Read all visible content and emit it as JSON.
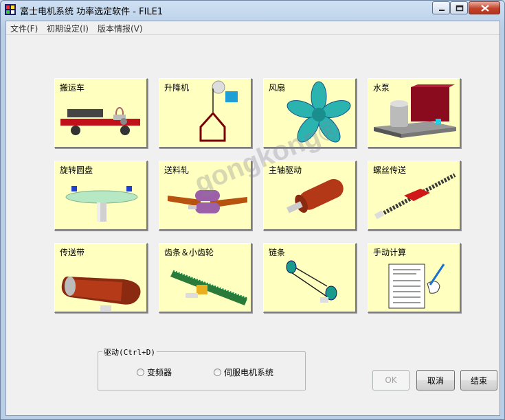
{
  "window": {
    "title": "富士电机系统  功率选定软件 - FILE1"
  },
  "menu": [
    {
      "label": "文件(F)"
    },
    {
      "label": "初期设定(I)"
    },
    {
      "label": "版本情报(V)"
    }
  ],
  "tiles": [
    {
      "label": "搬运车",
      "icon": "cart-icon"
    },
    {
      "label": "升降机",
      "icon": "hoist-icon"
    },
    {
      "label": "风扇",
      "icon": "fan-icon"
    },
    {
      "label": "水泵",
      "icon": "pump-icon"
    },
    {
      "label": "旋转圆盘",
      "icon": "turntable-icon"
    },
    {
      "label": "送料轧",
      "icon": "feed-roll-icon"
    },
    {
      "label": "主轴驱动",
      "icon": "spindle-icon"
    },
    {
      "label": "螺丝传送",
      "icon": "screw-conveyor-icon"
    },
    {
      "label": "传送带",
      "icon": "conveyor-belt-icon"
    },
    {
      "label": "齿条＆小齿轮",
      "icon": "rack-pinion-icon"
    },
    {
      "label": "链条",
      "icon": "chain-icon"
    },
    {
      "label": "手动计算",
      "icon": "manual-calc-icon"
    }
  ],
  "drive_group": {
    "label": "驱动(Ctrl+D)",
    "options": [
      {
        "label": "变频器",
        "selected": false
      },
      {
        "label": "伺服电机系统",
        "selected": false
      }
    ]
  },
  "buttons": {
    "ok": {
      "label": "OK",
      "enabled": false
    },
    "cancel": {
      "label": "取消"
    },
    "finish": {
      "label": "结束"
    }
  },
  "watermark": "gongkong®",
  "colors": {
    "tile_bg": "#ffffc0",
    "window_bg": "#f0f0f0"
  }
}
